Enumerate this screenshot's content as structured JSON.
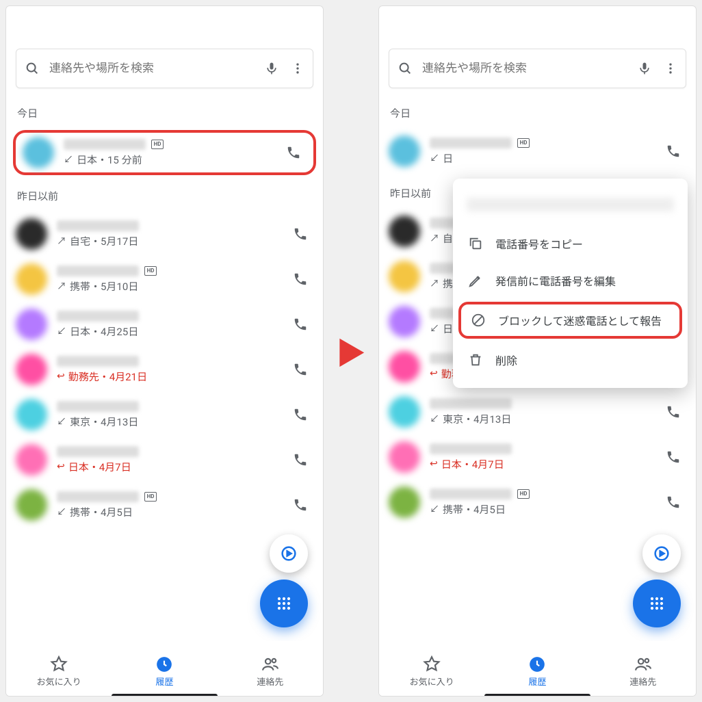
{
  "search": {
    "placeholder": "連絡先や場所を検索"
  },
  "sections": {
    "today": "今日",
    "before": "昨日以前"
  },
  "calls": {
    "today": {
      "meta": "日本・15 分前",
      "dir": "in",
      "hd": true,
      "avatar": "#5bc0de"
    },
    "list": [
      {
        "meta": "自宅・5月17日",
        "dir": "out",
        "hd": false,
        "avatar": "#2a2a2a",
        "missed": false
      },
      {
        "meta": "携帯・5月10日",
        "dir": "out",
        "hd": true,
        "avatar": "#f4c542",
        "missed": false
      },
      {
        "meta": "日本・4月25日",
        "dir": "in",
        "hd": false,
        "avatar": "#b47aff",
        "missed": false
      },
      {
        "meta": "勤務先・4月21日",
        "dir": "missed",
        "hd": false,
        "avatar": "#ff4fa3",
        "missed": true
      },
      {
        "meta": "東京・4月13日",
        "dir": "in",
        "hd": false,
        "avatar": "#4dd0e1",
        "missed": false
      },
      {
        "meta": "日本・4月7日",
        "dir": "missed",
        "hd": false,
        "avatar": "#ff6fb5",
        "missed": true
      },
      {
        "meta": "携帯・4月5日",
        "dir": "in",
        "hd": true,
        "avatar": "#7cb342",
        "missed": false
      }
    ]
  },
  "nav": {
    "fav": "お気に入り",
    "history": "履歴",
    "contacts": "連絡先"
  },
  "menu": {
    "copy": "電話番号をコピー",
    "edit": "発信前に電話番号を編集",
    "block": "ブロックして迷惑電話として報告",
    "delete": "削除"
  },
  "right_today_meta": "日"
}
